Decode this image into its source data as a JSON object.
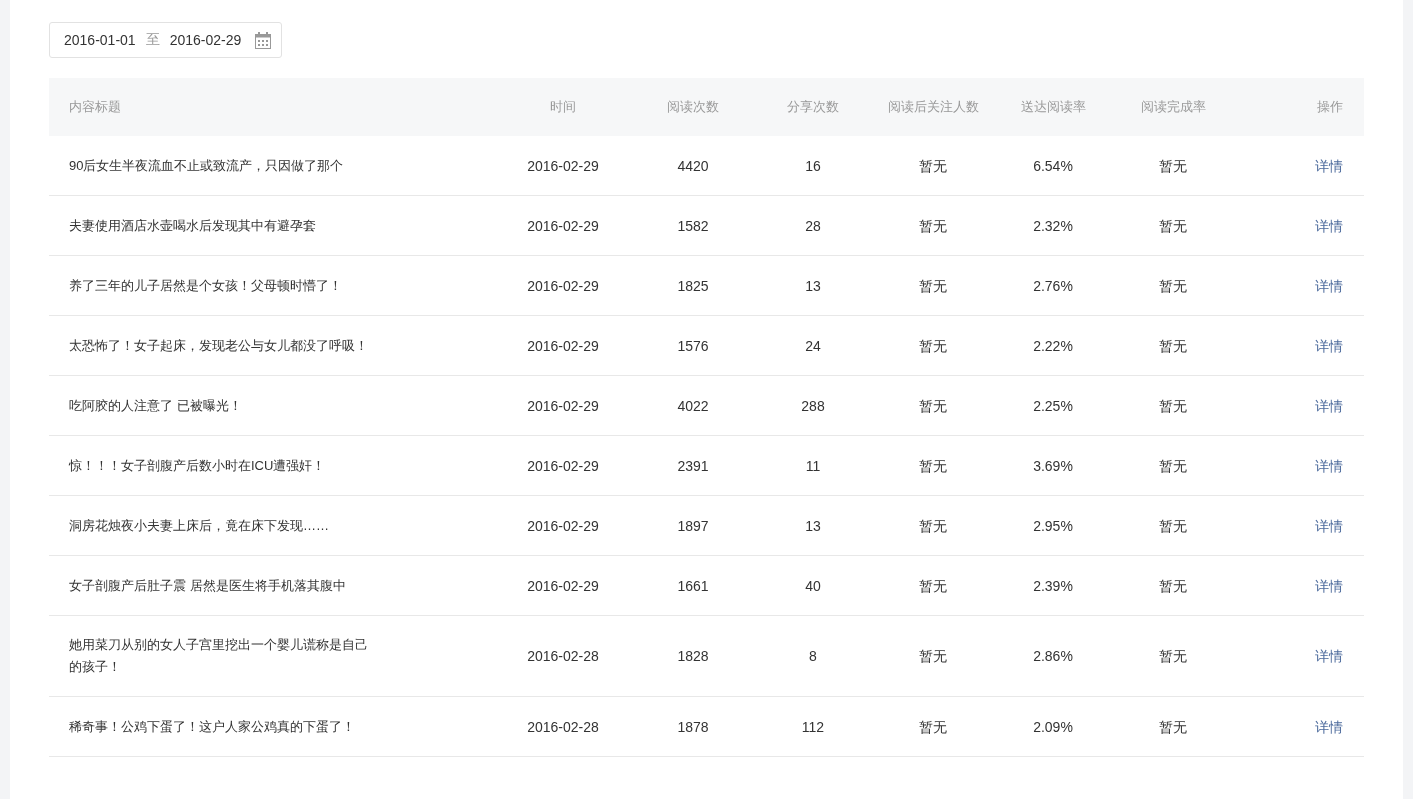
{
  "date_range": {
    "start": "2016-01-01",
    "separator": "至",
    "end": "2016-02-29"
  },
  "table": {
    "columns": [
      "内容标题",
      "时间",
      "阅读次数",
      "分享次数",
      "阅读后关注人数",
      "送达阅读率",
      "阅读完成率",
      "操作"
    ],
    "rows": [
      {
        "title": "90后女生半夜流血不止或致流产，只因做了那个",
        "time": "2016-02-29",
        "reads": "4420",
        "shares": "16",
        "follows": "暂无",
        "delivery_rate": "6.54%",
        "completion_rate": "暂无",
        "action": "详情"
      },
      {
        "title": "夫妻使用酒店水壶喝水后发现其中有避孕套",
        "time": "2016-02-29",
        "reads": "1582",
        "shares": "28",
        "follows": "暂无",
        "delivery_rate": "2.32%",
        "completion_rate": "暂无",
        "action": "详情"
      },
      {
        "title": "养了三年的儿子居然是个女孩！父母顿时懵了！",
        "time": "2016-02-29",
        "reads": "1825",
        "shares": "13",
        "follows": "暂无",
        "delivery_rate": "2.76%",
        "completion_rate": "暂无",
        "action": "详情"
      },
      {
        "title": "太恐怖了！女子起床，发现老公与女儿都没了呼吸！",
        "time": "2016-02-29",
        "reads": "1576",
        "shares": "24",
        "follows": "暂无",
        "delivery_rate": "2.22%",
        "completion_rate": "暂无",
        "action": "详情"
      },
      {
        "title": "吃阿胶的人注意了 已被曝光！",
        "time": "2016-02-29",
        "reads": "4022",
        "shares": "288",
        "follows": "暂无",
        "delivery_rate": "2.25%",
        "completion_rate": "暂无",
        "action": "详情"
      },
      {
        "title": "惊！！！女子剖腹产后数小时在ICU遭强奸！",
        "time": "2016-02-29",
        "reads": "2391",
        "shares": "11",
        "follows": "暂无",
        "delivery_rate": "3.69%",
        "completion_rate": "暂无",
        "action": "详情"
      },
      {
        "title": "洞房花烛夜小夫妻上床后，竟在床下发现……",
        "time": "2016-02-29",
        "reads": "1897",
        "shares": "13",
        "follows": "暂无",
        "delivery_rate": "2.95%",
        "completion_rate": "暂无",
        "action": "详情"
      },
      {
        "title": "女子剖腹产后肚子震 居然是医生将手机落其腹中",
        "time": "2016-02-29",
        "reads": "1661",
        "shares": "40",
        "follows": "暂无",
        "delivery_rate": "2.39%",
        "completion_rate": "暂无",
        "action": "详情"
      },
      {
        "title": "她用菜刀从别的女人子宫里挖出一个婴儿谎称是自己的孩子！",
        "time": "2016-02-28",
        "reads": "1828",
        "shares": "8",
        "follows": "暂无",
        "delivery_rate": "2.86%",
        "completion_rate": "暂无",
        "action": "详情"
      },
      {
        "title": "稀奇事！公鸡下蛋了！这户人家公鸡真的下蛋了！",
        "time": "2016-02-28",
        "reads": "1878",
        "shares": "112",
        "follows": "暂无",
        "delivery_rate": "2.09%",
        "completion_rate": "暂无",
        "action": "详情"
      }
    ]
  }
}
